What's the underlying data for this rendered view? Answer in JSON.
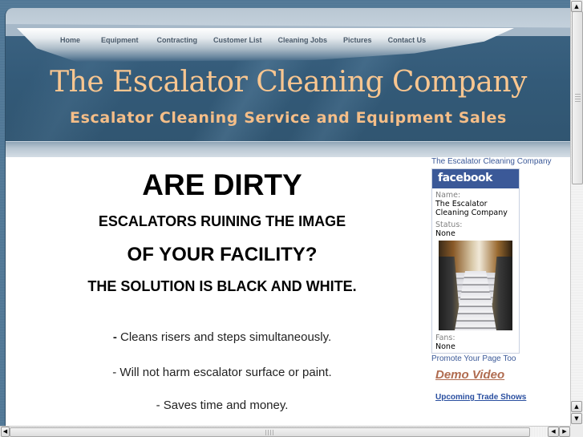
{
  "nav": {
    "items": [
      {
        "label": "Home"
      },
      {
        "label": "Equipment"
      },
      {
        "label": "Contracting"
      },
      {
        "label": "Customer List"
      },
      {
        "label": "Cleaning Jobs"
      },
      {
        "label": "Pictures"
      },
      {
        "label": "Contact Us"
      }
    ]
  },
  "header": {
    "title": "The Escalator Cleaning Company",
    "subtitle": "Escalator Cleaning Service and Equipment Sales"
  },
  "main": {
    "headline1": "ARE DIRTY",
    "headline2": "ESCALATORS RUINING THE IMAGE",
    "headline3": "OF YOUR FACILITY?",
    "headline4": "THE SOLUTION IS BLACK AND WHITE.",
    "bullets": [
      {
        "dash": "-",
        "text": " Cleans risers and steps simultaneously."
      },
      {
        "dash": "-",
        "text": " Will not harm escalator surface or paint."
      },
      {
        "dash": "-",
        "text": " Saves time and money."
      }
    ]
  },
  "sidebar": {
    "fb_page_link": "The Escalator Cleaning Company",
    "fb_brand": "facebook",
    "name_label": "Name:",
    "name_value": "The Escalator Cleaning Company",
    "status_label": "Status:",
    "status_value": "None",
    "fans_label": "Fans:",
    "fans_value": "None",
    "promote_link": "Promote Your Page Too",
    "demo_video_link": "Demo Video",
    "trade_shows_link": "Upcoming Trade Shows"
  },
  "scrollbars": {
    "up_icon": "▲",
    "down_icon": "▼",
    "left_icon": "◀",
    "right_icon": "▶",
    "vertical_position": 0.0,
    "horizontal_position": 0.0
  },
  "colors": {
    "title_color": "#f9c690",
    "header_blue": "#335a78",
    "facebook_blue": "#3b5998",
    "demo_link": "#b06c50",
    "trade_link": "#2a4fa0"
  }
}
